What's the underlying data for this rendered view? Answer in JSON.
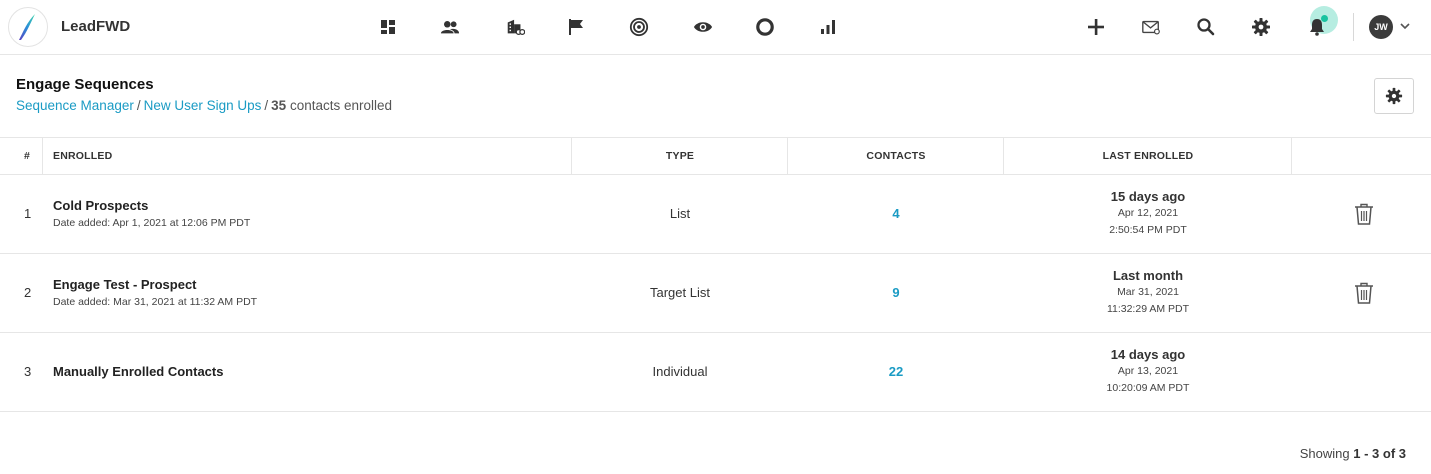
{
  "app": {
    "brand": "LeadFWD",
    "user_initials": "JW"
  },
  "nav_icons": [
    "dashboard-icon",
    "contacts-icon",
    "companies-icon",
    "flag-icon",
    "target-icon",
    "eye-icon",
    "circle-icon",
    "bar-chart-icon"
  ],
  "right_icons": [
    "plus-icon",
    "mail-icon",
    "search-icon",
    "gear-icon",
    "bell-icon"
  ],
  "page": {
    "title": "Engage Sequences",
    "breadcrumb": {
      "link1": "Sequence Manager",
      "sep1": "/",
      "link2": "New User Sign Ups",
      "sep2": "/",
      "count": "35",
      "suffix": "contacts enrolled"
    }
  },
  "table": {
    "headers": {
      "num": "#",
      "enrolled": "ENROLLED",
      "type": "TYPE",
      "contacts": "CONTACTS",
      "last": "LAST ENROLLED"
    },
    "rows": [
      {
        "num": "1",
        "name": "Cold Prospects",
        "date_added": "Date added: Apr 1, 2021 at 12:06 PM PDT",
        "type": "List",
        "contacts": "4",
        "last_rel": "15 days ago",
        "last_date": "Apr 12, 2021",
        "last_time": "2:50:54 PM PDT",
        "deletable": true
      },
      {
        "num": "2",
        "name": "Engage Test - Prospect",
        "date_added": "Date added: Mar 31, 2021 at 11:32 AM PDT",
        "type": "Target List",
        "contacts": "9",
        "last_rel": "Last month",
        "last_date": "Mar 31, 2021",
        "last_time": "11:32:29 AM PDT",
        "deletable": true
      },
      {
        "num": "3",
        "name": "Manually Enrolled Contacts",
        "date_added": "",
        "type": "Individual",
        "contacts": "22",
        "last_rel": "14 days ago",
        "last_date": "Apr 13, 2021",
        "last_time": "10:20:09 AM PDT",
        "deletable": false
      }
    ]
  },
  "footer": {
    "prefix": "Showing",
    "range": "1 - 3 of 3"
  },
  "colors": {
    "link": "#1a9bc4",
    "notification": "#19c3a0"
  }
}
